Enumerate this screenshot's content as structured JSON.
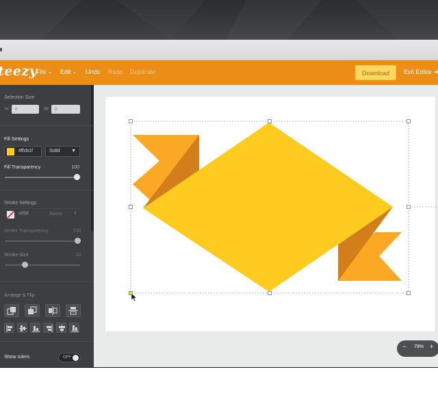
{
  "toolbar": {
    "brand": "teezy",
    "menu": {
      "file": "File",
      "edit": "Edit",
      "undo": "Undo",
      "redo": "Redo",
      "duplicate": "Duplicate"
    },
    "download": "Download",
    "exit_editor": "Exit Editor"
  },
  "sidebar": {
    "selection_size": {
      "title": "Selection Size",
      "h_label": "H:",
      "h_value": "0",
      "w_label": "W:",
      "w_value": "0"
    },
    "fill_settings": {
      "title": "Fill Settings",
      "color_hex": "#ffcb1f",
      "color_text": "#ffcb1f",
      "style": "Solid",
      "transparency_label": "Fill Transparency",
      "transparency_value": "100",
      "transparency_level": 100
    },
    "stroke_settings": {
      "title": "Stroke Settings",
      "color_text": "#ffffff",
      "position": "Above",
      "transparency_label": "Stroke Transparency",
      "transparency_value": "100",
      "transparency_level": 100,
      "size_label": "Stroke Size",
      "size_value": "10",
      "size_level": 0.28
    },
    "arrange": {
      "title": "Arrange & Flip"
    },
    "rulers": {
      "label": "Show rulers",
      "state": "OFF"
    }
  },
  "zoom": {
    "minus": "−",
    "level": "79%",
    "plus": "+"
  },
  "colors": {
    "accent": "#ec8d16",
    "download": "#fcd95e",
    "sidebar": "#3d3e41",
    "fill_yellow": "#ffcb1f",
    "fold_dark": "#d27f1b",
    "tail_orange": "#fba924"
  }
}
